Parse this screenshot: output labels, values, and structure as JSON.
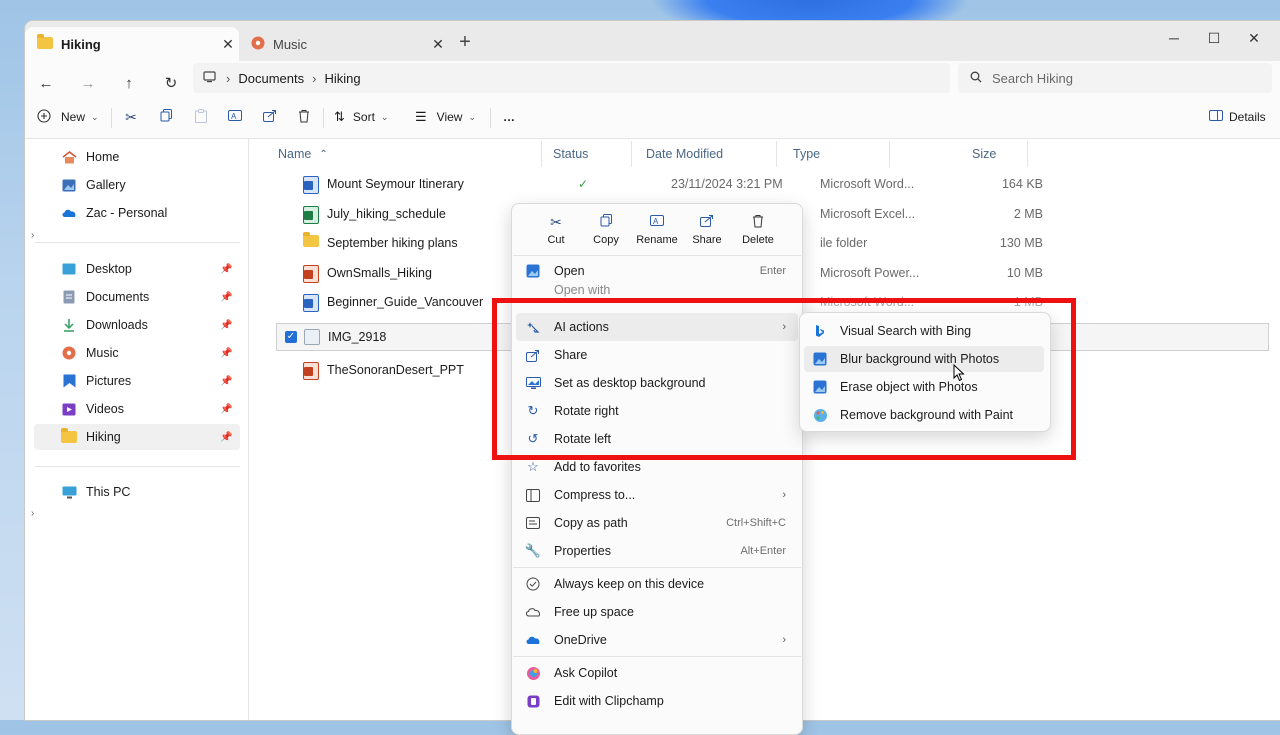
{
  "tabs": [
    {
      "label": "Hiking",
      "icon": "folder-icon"
    },
    {
      "label": "Music",
      "icon": "music-icon"
    }
  ],
  "window_controls": [
    "minimize",
    "maximize",
    "close"
  ],
  "breadcrumb": [
    "Documents",
    "Hiking"
  ],
  "search": {
    "placeholder": "Search Hiking"
  },
  "toolbar": {
    "new_label": "New",
    "sort_label": "Sort",
    "view_label": "View",
    "more_label": "…",
    "details_label": "Details"
  },
  "sidebar": {
    "top": [
      {
        "label": "Home",
        "icon": "home-icon"
      },
      {
        "label": "Gallery",
        "icon": "gallery-icon"
      },
      {
        "label": "Zac - Personal",
        "icon": "onedrive-icon"
      }
    ],
    "pinned": [
      {
        "label": "Desktop",
        "icon": "desktop-icon"
      },
      {
        "label": "Documents",
        "icon": "documents-icon"
      },
      {
        "label": "Downloads",
        "icon": "downloads-icon"
      },
      {
        "label": "Music",
        "icon": "music-icon"
      },
      {
        "label": "Pictures",
        "icon": "pictures-icon"
      },
      {
        "label": "Videos",
        "icon": "videos-icon"
      },
      {
        "label": "Hiking",
        "icon": "folder-icon"
      }
    ],
    "bottom": [
      {
        "label": "This PC",
        "icon": "pc-icon"
      }
    ]
  },
  "columns": {
    "name": "Name",
    "status": "Status",
    "date": "Date Modified",
    "type": "Type",
    "size": "Size"
  },
  "files": [
    {
      "name": "Mount Seymour Itinerary",
      "kind": "word",
      "date": "23/11/2024 3:21 PM",
      "type": "Microsoft Word...",
      "size": "164 KB",
      "status": "✓"
    },
    {
      "name": "July_hiking_schedule",
      "kind": "excel",
      "date": "",
      "type": "Microsoft Excel...",
      "size": "2 MB",
      "status": ""
    },
    {
      "name": "September hiking plans",
      "kind": "folder",
      "date": "",
      "type": "ile folder",
      "size": "130 MB",
      "status": ""
    },
    {
      "name": "OwnSmalls_Hiking",
      "kind": "ppt",
      "date": "",
      "type": "Microsoft Power...",
      "size": "10 MB",
      "status": ""
    },
    {
      "name": "Beginner_Guide_Vancouver",
      "kind": "word",
      "date": "",
      "type": "Microsoft Word...",
      "size": "1 MB",
      "status": ""
    },
    {
      "name": "IMG_2918",
      "kind": "image",
      "date": "",
      "type": "",
      "size": "",
      "status": ""
    },
    {
      "name": "TheSonoranDesert_PPT",
      "kind": "ppt",
      "date": "",
      "type": "",
      "size": "",
      "status": ""
    }
  ],
  "context_menu": {
    "quick_actions": [
      {
        "label": "Cut",
        "icon": "cut-icon"
      },
      {
        "label": "Copy",
        "icon": "copy-icon"
      },
      {
        "label": "Rename",
        "icon": "rename-icon"
      },
      {
        "label": "Share",
        "icon": "share-icon"
      },
      {
        "label": "Delete",
        "icon": "delete-icon"
      }
    ],
    "items": [
      {
        "label": "Open",
        "shortcut": "Enter",
        "icon": "open-icon"
      },
      {
        "label": "Open with",
        "shortcut": "",
        "icon": "open-with-icon"
      },
      {
        "label": "AI actions",
        "shortcut": "",
        "icon": "ai-actions-icon"
      },
      {
        "label": "Share",
        "shortcut": "",
        "icon": "share-icon"
      },
      {
        "label": "Set as desktop background",
        "shortcut": "",
        "icon": "desktop-background-icon"
      },
      {
        "label": "Rotate right",
        "shortcut": "",
        "icon": "rotate-right-icon"
      },
      {
        "label": "Rotate left",
        "shortcut": "",
        "icon": "rotate-left-icon"
      },
      {
        "label": "Add to favorites",
        "shortcut": "",
        "icon": "star-icon"
      },
      {
        "label": "Compress to...",
        "shortcut": "",
        "icon": "compress-icon"
      },
      {
        "label": "Copy as path",
        "shortcut": "Ctrl+Shift+C",
        "icon": "copy-path-icon"
      },
      {
        "label": "Properties",
        "shortcut": "Alt+Enter",
        "icon": "properties-icon"
      },
      {
        "label": "Always keep on this device",
        "shortcut": "",
        "icon": "keep-device-icon"
      },
      {
        "label": "Free up space",
        "shortcut": "",
        "icon": "cloud-icon"
      },
      {
        "label": "OneDrive",
        "shortcut": "",
        "icon": "onedrive-icon"
      },
      {
        "label": "Ask Copilot",
        "shortcut": "",
        "icon": "copilot-icon"
      },
      {
        "label": "Edit with Clipchamp",
        "shortcut": "",
        "icon": "clipchamp-icon"
      }
    ]
  },
  "submenu": [
    {
      "label": "Visual Search with Bing",
      "icon": "bing-icon"
    },
    {
      "label": "Blur background with Photos",
      "icon": "photos-icon"
    },
    {
      "label": "Erase object with Photos",
      "icon": "photos-icon"
    },
    {
      "label": "Remove background with Paint",
      "icon": "paint-icon"
    }
  ],
  "colors": {
    "accent": "#1f6fd6",
    "highlight_box": "#ee1111",
    "status_ok": "#2e9e3f"
  }
}
